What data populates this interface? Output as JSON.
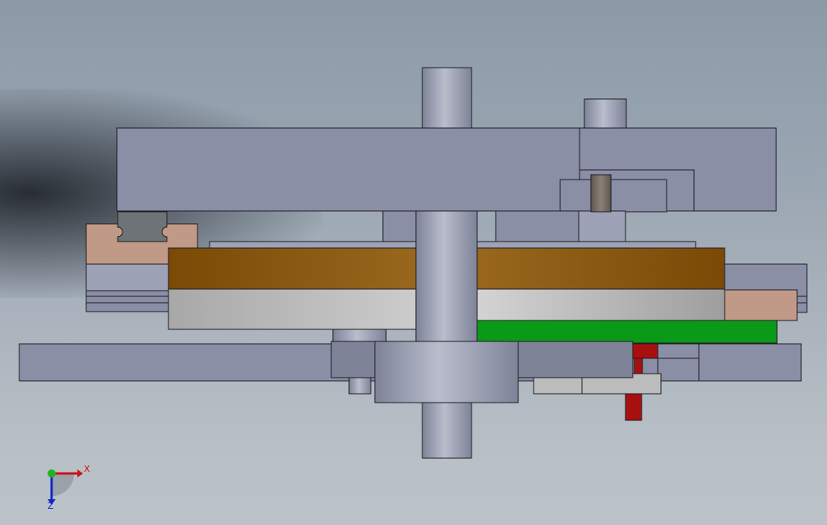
{
  "viewport": {
    "background_top": "#8c9aa8",
    "background_bottom": "#bcc2c8"
  },
  "model": {
    "colors": {
      "steel": "#8a8fa6",
      "steel_light": "#9da2b6",
      "shaft": "#a4a9bc",
      "bronze": "#8c5a10",
      "silver": "#c4c4c4",
      "green": "#0a9a18",
      "red": "#a81010",
      "tan": "#c09a86",
      "dark": "#1e1e22"
    }
  },
  "triad": {
    "x_label": "X",
    "z_label": "Z",
    "x_color": "#c81414",
    "y_color": "#1eb41e",
    "z_color": "#1428c8"
  }
}
